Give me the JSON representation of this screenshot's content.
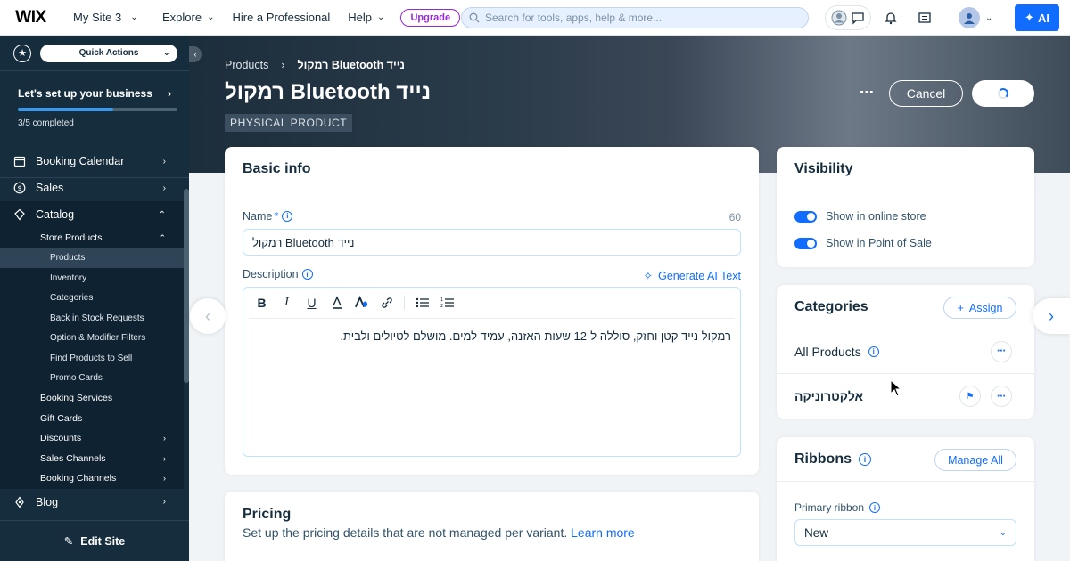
{
  "topbar": {
    "logo": "WIX",
    "site_name": "My Site 3",
    "nav": [
      "Explore",
      "Hire a Professional",
      "Help"
    ],
    "upgrade_label": "Upgrade",
    "search_placeholder": "Search for tools, apps, help & more...",
    "ai_label": "AI",
    "colors": {
      "accent": "#116dff",
      "upgrade": "#9a27d5"
    }
  },
  "sidebar": {
    "quick_actions_label": "Quick Actions",
    "setup_title": "Let's set up your business",
    "setup_progress": "3/5 completed",
    "setup_progress_fraction": 0.6,
    "items": [
      {
        "label": "Booking Calendar",
        "icon": "calendar-icon"
      },
      {
        "label": "Sales",
        "icon": "dollar-icon"
      },
      {
        "label": "Catalog",
        "icon": "catalog-icon"
      }
    ],
    "catalog_sub": {
      "store_products": "Store Products",
      "store_products_children": [
        "Products",
        "Inventory",
        "Categories",
        "Back in Stock Requests",
        "Option & Modifier Filters",
        "Find Products to Sell",
        "Promo Cards"
      ],
      "others": [
        "Booking Services",
        "Gift Cards",
        "Discounts",
        "Sales Channels",
        "Booking Channels"
      ]
    },
    "blog_label": "Blog",
    "edit_site_label": "Edit Site"
  },
  "header": {
    "breadcrumb_root": "Products",
    "breadcrumb_current": "רמקול Bluetooth נייד",
    "title": "רמקול Bluetooth נייד",
    "badge": "PHYSICAL PRODUCT",
    "cancel_label": "Cancel"
  },
  "basic_info": {
    "title": "Basic info",
    "name_label": "Name",
    "name_required_mark": "*",
    "name_counter": "60",
    "name_value": "רמקול Bluetooth נייד",
    "description_label": "Description",
    "generate_ai_label": "Generate AI Text",
    "description_value": "רמקול נייד קטן וחזק, סוללה ל-12 שעות האזנה, עמיד למים. מושלם לטיולים ולבית."
  },
  "pricing": {
    "title": "Pricing",
    "subtitle": "Set up the pricing details that are not managed per variant.",
    "learn_more": "Learn more"
  },
  "visibility": {
    "title": "Visibility",
    "options": [
      "Show in online store",
      "Show in Point of Sale"
    ]
  },
  "categories": {
    "title": "Categories",
    "assign_label": "Assign",
    "rows": [
      "All Products",
      "אלקטרוניקה"
    ]
  },
  "ribbons": {
    "title": "Ribbons",
    "manage_label": "Manage All",
    "primary_label": "Primary ribbon",
    "primary_value": "New"
  }
}
